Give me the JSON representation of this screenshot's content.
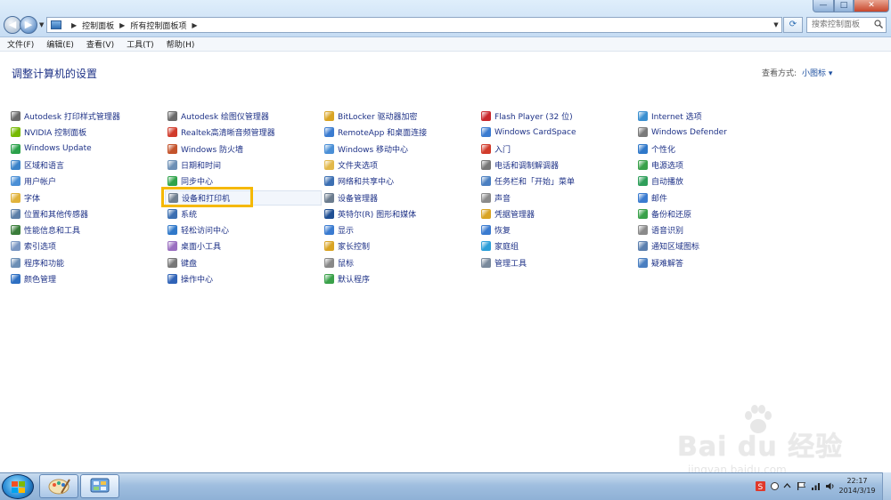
{
  "window": {
    "address_crumbs": [
      "控制面板",
      "所有控制面板项"
    ],
    "search_placeholder": "搜索控制面板",
    "controls": {
      "minimize": "—",
      "maximize": "□",
      "close": "✕"
    }
  },
  "menu": [
    "文件(F)",
    "编辑(E)",
    "查看(V)",
    "工具(T)",
    "帮助(H)"
  ],
  "page": {
    "title": "调整计算机的设置",
    "view_by_label": "查看方式:",
    "view_by_value": "小图标 ▾"
  },
  "columns": [
    {
      "items": [
        {
          "label": "Autodesk 打印样式管理器",
          "icon": "printer-style-icon",
          "color": "#6a6a6a"
        },
        {
          "label": "NVIDIA 控制面板",
          "icon": "nvidia-icon",
          "color": "#76b900"
        },
        {
          "label": "Windows Update",
          "icon": "windows-update-icon",
          "color": "#2aa14a"
        },
        {
          "label": "区域和语言",
          "icon": "globe-clock-icon",
          "color": "#3b83c9"
        },
        {
          "label": "用户帐户",
          "icon": "users-icon",
          "color": "#4a8fd6"
        },
        {
          "label": "字体",
          "icon": "font-folder-icon",
          "color": "#e0b23a"
        },
        {
          "label": "位置和其他传感器",
          "icon": "sensor-icon",
          "color": "#5d7fa8"
        },
        {
          "label": "性能信息和工具",
          "icon": "performance-icon",
          "color": "#3a7d3a"
        },
        {
          "label": "索引选项",
          "icon": "index-icon",
          "color": "#7a96c2"
        },
        {
          "label": "程序和功能",
          "icon": "programs-icon",
          "color": "#6c8fb5"
        },
        {
          "label": "颜色管理",
          "icon": "color-management-icon",
          "color": "#2d6fc2"
        }
      ]
    },
    {
      "items": [
        {
          "label": "Autodesk 绘图仪管理器",
          "icon": "plotter-icon",
          "color": "#6a6a6a"
        },
        {
          "label": "Realtek高清晰音频管理器",
          "icon": "speaker-icon",
          "color": "#d13b2b"
        },
        {
          "label": "Windows 防火墙",
          "icon": "firewall-icon",
          "color": "#c4532b"
        },
        {
          "label": "日期和时间",
          "icon": "calendar-icon",
          "color": "#6c8fb5"
        },
        {
          "label": "同步中心",
          "icon": "sync-icon",
          "color": "#2fa34a"
        },
        {
          "label": "设备和打印机",
          "icon": "devices-printers-icon",
          "color": "#6f7f90"
        },
        {
          "label": "系统",
          "icon": "system-icon",
          "color": "#3b6fb2"
        },
        {
          "label": "轻松访问中心",
          "icon": "ease-of-access-icon",
          "color": "#2f78c9"
        },
        {
          "label": "桌面小工具",
          "icon": "gadgets-icon",
          "color": "#9a6fc0"
        },
        {
          "label": "键盘",
          "icon": "keyboard-icon",
          "color": "#777777"
        },
        {
          "label": "操作中心",
          "icon": "action-center-flag-icon",
          "color": "#2f63b7"
        }
      ]
    },
    {
      "items": [
        {
          "label": "BitLocker 驱动器加密",
          "icon": "bitlocker-icon",
          "color": "#d9a424"
        },
        {
          "label": "RemoteApp 和桌面连接",
          "icon": "remoteapp-icon",
          "color": "#3a7bd0"
        },
        {
          "label": "Windows 移动中心",
          "icon": "mobility-center-icon",
          "color": "#4a8fd6"
        },
        {
          "label": "文件夹选项",
          "icon": "folder-options-icon",
          "color": "#e2b84a"
        },
        {
          "label": "网络和共享中心",
          "icon": "network-icon",
          "color": "#3b6fb2"
        },
        {
          "label": "设备管理器",
          "icon": "device-manager-icon",
          "color": "#6b7c8e"
        },
        {
          "label": "英特尔(R) 图形和媒体",
          "icon": "intel-graphics-icon",
          "color": "#1f4f94"
        },
        {
          "label": "显示",
          "icon": "display-icon",
          "color": "#3a7bd0"
        },
        {
          "label": "家长控制",
          "icon": "parental-controls-icon",
          "color": "#d9a424"
        },
        {
          "label": "鼠标",
          "icon": "mouse-icon",
          "color": "#888888"
        },
        {
          "label": "默认程序",
          "icon": "default-programs-icon",
          "color": "#3aa14a"
        }
      ]
    },
    {
      "items": [
        {
          "label": "Flash Player (32 位)",
          "icon": "flash-icon",
          "color": "#c9282d"
        },
        {
          "label": "Windows CardSpace",
          "icon": "cardspace-icon",
          "color": "#3a7bd0"
        },
        {
          "label": "入门",
          "icon": "getting-started-icon",
          "color": "#d13b2b"
        },
        {
          "label": "电话和调制解调器",
          "icon": "phone-modem-icon",
          "color": "#777777"
        },
        {
          "label": "任务栏和「开始」菜单",
          "icon": "taskbar-icon",
          "color": "#4a7fc1"
        },
        {
          "label": "声音",
          "icon": "sound-icon",
          "color": "#8a8a8a"
        },
        {
          "label": "凭据管理器",
          "icon": "credential-icon",
          "color": "#d9a424"
        },
        {
          "label": "恢复",
          "icon": "recovery-icon",
          "color": "#3a7bd0"
        },
        {
          "label": "家庭组",
          "icon": "homegroup-icon",
          "color": "#2d9fd8"
        },
        {
          "label": "管理工具",
          "icon": "admin-tools-icon",
          "color": "#7a8a9c"
        }
      ]
    },
    {
      "items": [
        {
          "label": "Internet 选项",
          "icon": "internet-options-icon",
          "color": "#3a8fd0"
        },
        {
          "label": "Windows Defender",
          "icon": "defender-icon",
          "color": "#7a7a7a"
        },
        {
          "label": "个性化",
          "icon": "personalization-icon",
          "color": "#2f78c9"
        },
        {
          "label": "电源选项",
          "icon": "power-icon",
          "color": "#3aa14a"
        },
        {
          "label": "自动播放",
          "icon": "autoplay-icon",
          "color": "#2f9f5a"
        },
        {
          "label": "邮件",
          "icon": "mail-icon",
          "color": "#3a7bd0"
        },
        {
          "label": "备份和还原",
          "icon": "backup-icon",
          "color": "#3aa14a"
        },
        {
          "label": "语音识别",
          "icon": "microphone-icon",
          "color": "#8a8a8a"
        },
        {
          "label": "通知区域图标",
          "icon": "notification-area-icon",
          "color": "#5b7fae"
        },
        {
          "label": "疑难解答",
          "icon": "troubleshooting-icon",
          "color": "#4a7fc1"
        }
      ]
    }
  ],
  "watermark": {
    "brand": "Bai du 经验",
    "url": "jingyan.baidu.com"
  },
  "taskbar": {
    "clock_time": "22:17",
    "clock_date": "2014/3/19"
  },
  "colors": {
    "link": "#1e3287",
    "title": "#1e3287",
    "highlight_box": "#f5b800"
  }
}
